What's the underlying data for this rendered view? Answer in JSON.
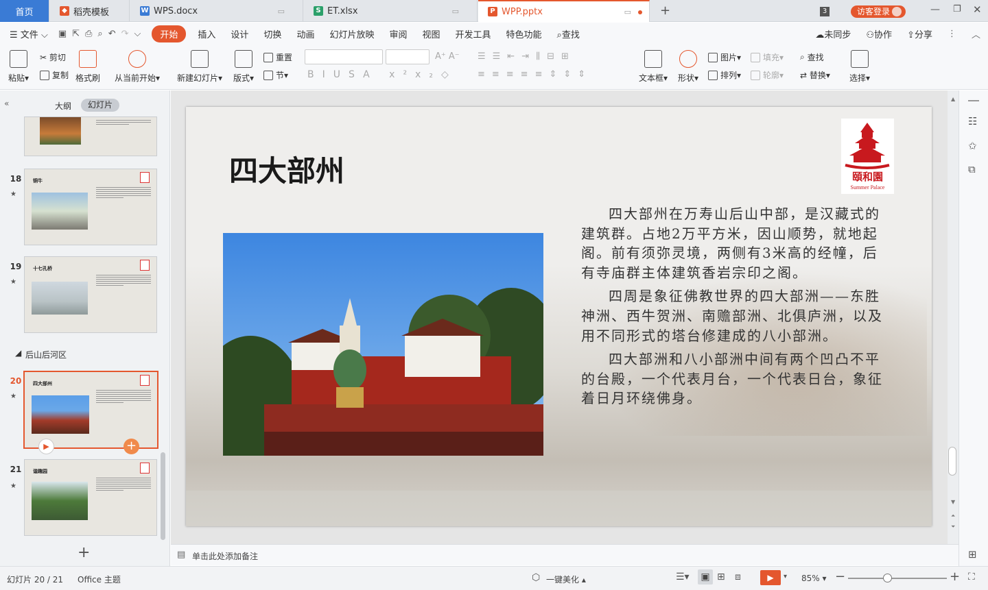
{
  "tabs": {
    "home": "首页",
    "t1": "稻壳模板",
    "t2": "WPS.docx",
    "t3": "ET.xlsx",
    "t4": "WPP.pptx",
    "count": "3",
    "login": "访客登录"
  },
  "menu": {
    "file": "文件",
    "items": [
      "开始",
      "插入",
      "设计",
      "切换",
      "动画",
      "幻灯片放映",
      "审阅",
      "视图",
      "开发工具",
      "特色功能"
    ],
    "search": "查找",
    "sync": "未同步",
    "collab": "协作",
    "share": "分享"
  },
  "ribbon": {
    "paste": "粘贴",
    "cut": "剪切",
    "copy": "复制",
    "format_painter": "格式刷",
    "from_current": "从当前开始",
    "new_slide": "新建幻灯片",
    "layout": "版式",
    "reset": "重置",
    "section": "节",
    "textbox": "文本框",
    "shape": "形状",
    "picture": "图片",
    "fill": "填充",
    "arrange": "排列",
    "outline": "轮廓",
    "find": "查找",
    "replace": "替换",
    "select": "选择"
  },
  "panel": {
    "tab_outline": "大纲",
    "tab_slides": "幻灯片",
    "section_label": "后山后河区",
    "slides": [
      {
        "num": "18",
        "title": "铜牛"
      },
      {
        "num": "19",
        "title": "十七孔桥"
      },
      {
        "num": "20",
        "title": "四大部州"
      },
      {
        "num": "21",
        "title": "谐趣园"
      }
    ],
    "add": "+"
  },
  "slide": {
    "title": "四大部州",
    "logo_text": "頤和園",
    "logo_sub": "Summer Palace",
    "para1": "四大部州在万寿山后山中部，是汉藏式的建筑群。占地2万平方米，因山顺势，就地起阁。前有须弥灵境，两侧有3米高的经幢，后有寺庙群主体建筑香岩宗印之阁。",
    "para2": "四周是象征佛教世界的四大部洲——东胜神洲、西牛贺洲、南赡部洲、北俱庐洲，以及用不同形式的塔台修建成的八小部洲。",
    "para3": "四大部洲和八小部洲中间有两个凹凸不平的台殿，一个代表月台，一个代表日台，象征着日月环绕佛身。"
  },
  "notes_placeholder": "单击此处添加备注",
  "status": {
    "slide_count": "幻灯片 20 / 21",
    "theme": "Office 主题",
    "beautify": "一键美化",
    "zoom": "85%"
  },
  "colors": {
    "accent": "#e4572e",
    "blue": "#3a7bd5"
  }
}
